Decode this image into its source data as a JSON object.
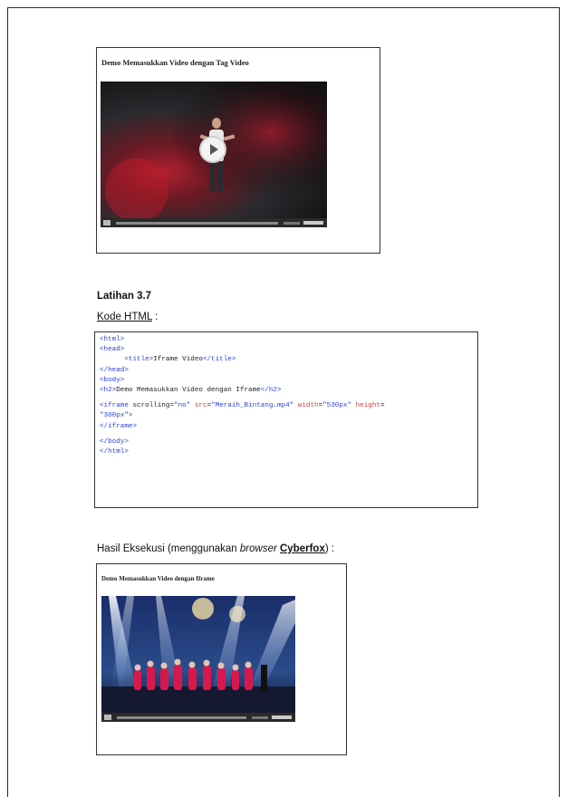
{
  "shot1": {
    "title": "Demo Memasukkan Video dengan Tag Video"
  },
  "section": {
    "heading": "Latihan 3.7",
    "code_label": "Kode HTML",
    "code_label_suffix": " :"
  },
  "code": {
    "l1": "<html>",
    "l2": "<head>",
    "l3_open": "<title>",
    "l3_text": "Iframe Video",
    "l3_close": "</title>",
    "l4": "</head>",
    "l5": "<body>",
    "l6_open": "<h2>",
    "l6_text": "Demo Memasukkan Video dengan Iframe",
    "l6_close": "</h2>",
    "l7_tag": "<iframe",
    "l7_attr1": " scrolling",
    "l7_eq1": "=",
    "l7_val1": "\"no\"",
    "l7_attr2": " src",
    "l7_eq2": "=",
    "l7_val2": "\"Meraih_Bintang.mp4\"",
    "l7_attr3": " width",
    "l7_eq3": "=",
    "l7_val3": "\"530px\"",
    "l7_attr4": " height",
    "l7_eq4": "=",
    "l8_val4": "\"300px\"",
    "l8_close": ">",
    "l9": "</iframe>",
    "l10": "</body>",
    "l11": "</html>"
  },
  "result": {
    "prefix": "Hasil Eksekusi (menggunakan ",
    "browser": "browser",
    "space": " ",
    "name": "Cyberfox",
    "suffix": ") :"
  },
  "shot2": {
    "title": "Demo Memasukkan Video dengan Iframe"
  }
}
